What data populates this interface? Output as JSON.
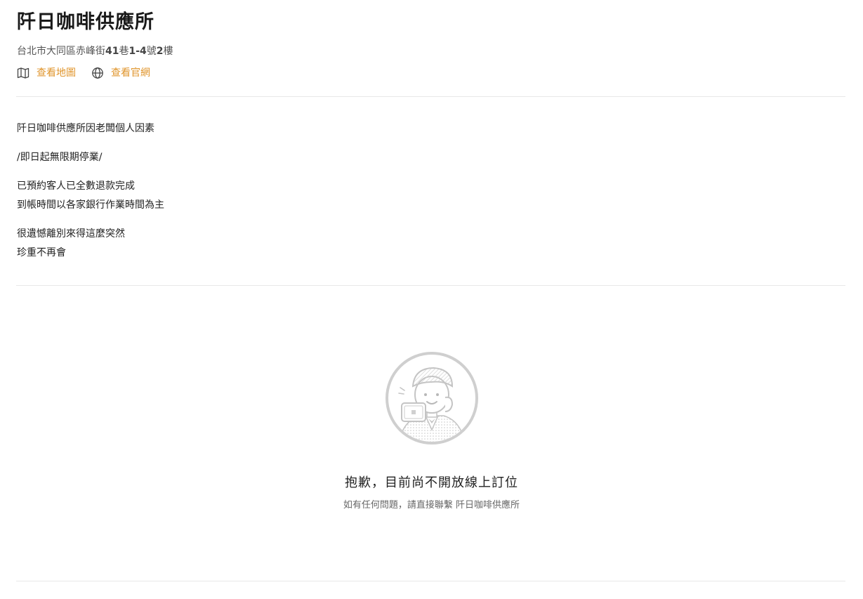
{
  "restaurant": {
    "name": "阡日咖啡供應所",
    "address_parts": [
      "台北市大同區赤峰街",
      "41",
      "巷",
      "1-4",
      "號",
      "2",
      "樓"
    ]
  },
  "links": {
    "map_label": "查看地圖",
    "website_label": "查看官網"
  },
  "notice": {
    "line1": "阡日咖啡供應所因老闆個人因素",
    "line2": "/即日起無限期停業/",
    "line3": "已預約客人已全數退款完成",
    "line4": "到帳時間以各家銀行作業時間為主",
    "line5": "很遺憾離別來得這麼突然",
    "line6": "珍重不再會"
  },
  "empty_state": {
    "title": "抱歉，目前尚不開放線上訂位",
    "subtitle": "如有任何問題，請直接聯繫 阡日咖啡供應所",
    "illustration_icon": "waiter-with-tablet-icon"
  },
  "colors": {
    "accent": "#e0952c",
    "divider": "#e8e8e8"
  }
}
